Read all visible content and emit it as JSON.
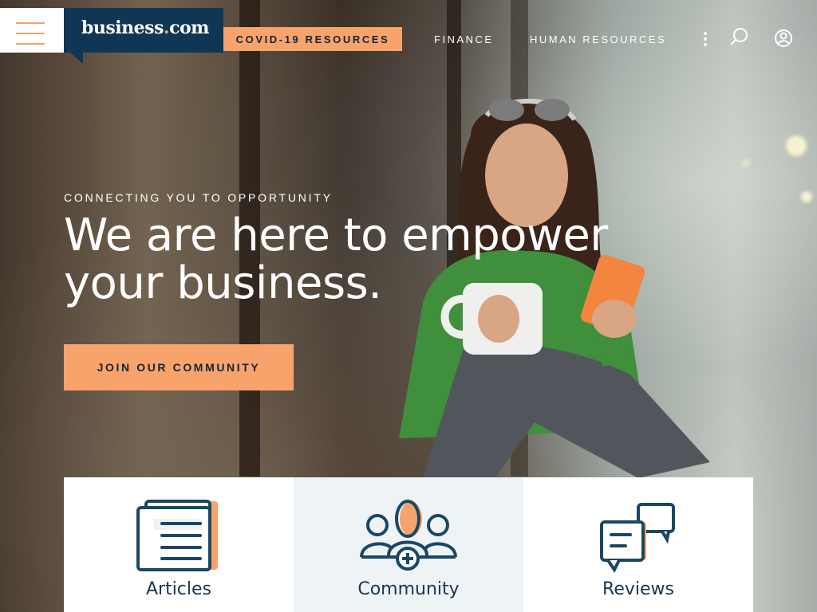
{
  "header": {
    "logo": {
      "text_main": "business",
      "text_dot": ".",
      "text_tld": "com"
    },
    "covid_label": "COVID-19 RESOURCES",
    "nav": [
      {
        "label": "FINANCE"
      },
      {
        "label": "HUMAN RESOURCES"
      }
    ],
    "icons": {
      "menu": "hamburger-icon",
      "more": "kebab-icon",
      "search": "search-icon",
      "account": "user-icon"
    }
  },
  "hero": {
    "tagline": "CONNECTING YOU TO OPPORTUNITY",
    "headline_line1": "We are here to empower",
    "headline_line2": "your business.",
    "cta_label": "JOIN OUR COMMUNITY"
  },
  "cards": [
    {
      "label": "Articles",
      "icon": "articles-icon"
    },
    {
      "label": "Community",
      "icon": "community-icon"
    },
    {
      "label": "Reviews",
      "icon": "reviews-icon"
    }
  ],
  "colors": {
    "brand_navy": "#0f3755",
    "accent_orange": "#f8a36c",
    "card_alt_bg": "#eef3f6"
  }
}
